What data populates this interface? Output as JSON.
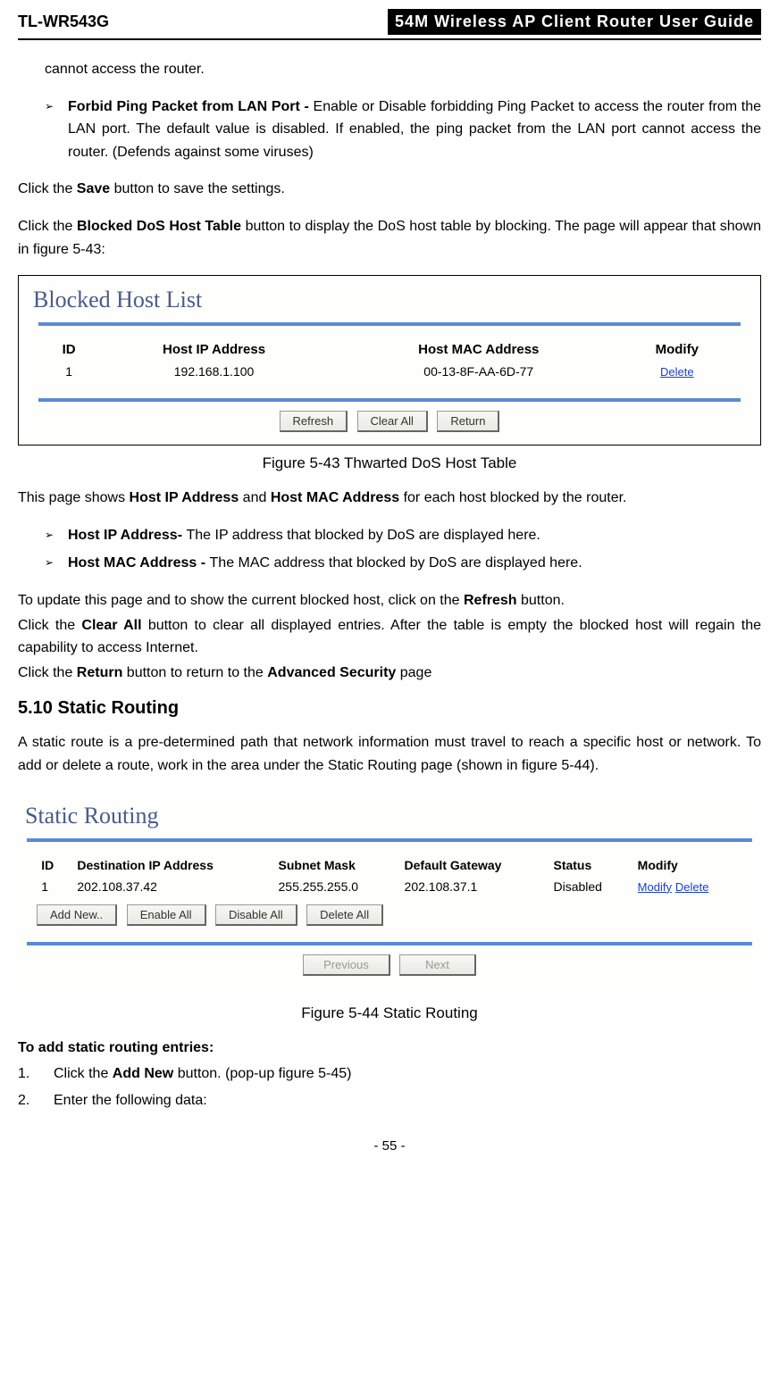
{
  "header": {
    "left": "TL-WR543G",
    "right": "54M Wireless AP Client Router User Guide"
  },
  "intro_fragment": "cannot access the router.",
  "bullets_top": [
    {
      "bold": "Forbid Ping Packet from LAN Port - ",
      "rest": "Enable or Disable forbidding Ping Packet to access the router from the LAN port. The default value is disabled. If enabled, the ping packet from the LAN port cannot access the router. (Defends against some viruses)"
    }
  ],
  "para_save_pre": "Click the ",
  "para_save_bold": "Save",
  "para_save_post": " button to save the settings.",
  "para_blocked_pre": "Click the ",
  "para_blocked_bold": "Blocked DoS Host Table",
  "para_blocked_post": " button to display the DoS host table by blocking. The page will appear that shown in figure 5-43:",
  "fig543": {
    "title": "Blocked Host List",
    "headers": {
      "id": "ID",
      "ip": "Host IP Address",
      "mac": "Host MAC Address",
      "modify": "Modify"
    },
    "rows": [
      {
        "id": "1",
        "ip": "192.168.1.100",
        "mac": "00-13-8F-AA-6D-77",
        "modify": "Delete"
      }
    ],
    "buttons": {
      "refresh": "Refresh",
      "clearall": "Clear All",
      "return": "Return"
    },
    "caption": "Figure 5-43    Thwarted DoS Host Table"
  },
  "para_thispage_pre": "This page shows ",
  "para_thispage_b1": "Host IP Address",
  "para_thispage_mid": " and ",
  "para_thispage_b2": "Host MAC Address",
  "para_thispage_post": " for each host blocked by the router.",
  "bullets_mid": [
    {
      "bold": "Host IP Address- ",
      "rest": "The IP address that blocked by DoS are displayed here."
    },
    {
      "bold": "Host MAC Address - ",
      "rest": "The MAC address that blocked by DoS are displayed here."
    }
  ],
  "para_refresh_pre": "To update this page and to show the current blocked host, click on the ",
  "para_refresh_bold": "Refresh",
  "para_refresh_post": " button.",
  "para_clear_pre": "Click the ",
  "para_clear_bold": "Clear All",
  "para_clear_post": " button to clear all displayed entries. After the table is empty the blocked host will regain the capability to access Internet.",
  "para_return_pre": "Click the ",
  "para_return_b1": "Return",
  "para_return_mid": " button to return to the ",
  "para_return_b2": "Advanced Security",
  "para_return_post": " page",
  "section_heading": "5.10 Static Routing",
  "para_static": "A static route is a pre-determined path that network information must travel to reach a specific host or network. To add or delete a route, work in the area under the Static Routing page (shown in figure 5-44).",
  "fig544": {
    "title": "Static Routing",
    "headers": {
      "id": "ID",
      "dest": "Destination IP Address",
      "mask": "Subnet Mask",
      "gw": "Default Gateway",
      "status": "Status",
      "modify": "Modify"
    },
    "rows": [
      {
        "id": "1",
        "dest": "202.108.37.42",
        "mask": "255.255.255.0",
        "gw": "202.108.37.1",
        "status": "Disabled",
        "modify1": "Modify",
        "modify2": "Delete"
      }
    ],
    "buttons_left": {
      "addnew": "Add New..",
      "enableall": "Enable All",
      "disableall": "Disable All",
      "deleteall": "Delete All"
    },
    "buttons_center": {
      "prev": "Previous",
      "next": "Next"
    },
    "caption": "Figure 5-44    Static Routing"
  },
  "add_heading": "To add static routing entries:",
  "ol": [
    {
      "num": "1.",
      "pre": "Click the ",
      "bold": "Add New",
      "post": " button. (pop-up figure 5-45)"
    },
    {
      "num": "2.",
      "pre": "Enter the following data:",
      "bold": "",
      "post": ""
    }
  ],
  "page_number": "- 55 -"
}
